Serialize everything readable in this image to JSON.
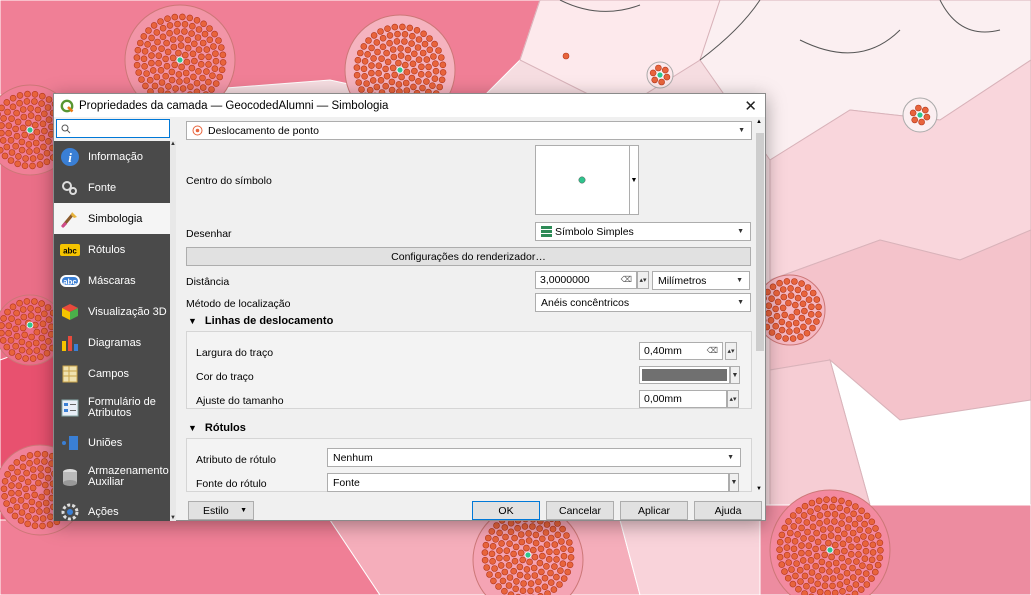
{
  "dialog": {
    "title": "Propriedades da camada — GeocodedAlumni — Simbologia",
    "close_glyph": "✕"
  },
  "sidebar": {
    "search_placeholder": "",
    "items": [
      {
        "label": "Informação",
        "icon": "info-icon"
      },
      {
        "label": "Fonte",
        "icon": "source-icon"
      },
      {
        "label": "Simbologia",
        "icon": "symbology-icon",
        "active": true
      },
      {
        "label": "Rótulos",
        "icon": "labels-icon"
      },
      {
        "label": "Máscaras",
        "icon": "masks-icon"
      },
      {
        "label": "Visualização 3D",
        "icon": "3d-view-icon"
      },
      {
        "label": "Diagramas",
        "icon": "diagrams-icon"
      },
      {
        "label": "Campos",
        "icon": "fields-icon"
      },
      {
        "label": "Formulário de Atributos",
        "icon": "attributes-form-icon"
      },
      {
        "label": "Uniões",
        "icon": "joins-icon"
      },
      {
        "label": "Armazenamento Auxiliar",
        "icon": "aux-storage-icon"
      },
      {
        "label": "Ações",
        "icon": "actions-icon"
      }
    ],
    "badge_abc": "abc"
  },
  "renderer": {
    "type": "Deslocamento de ponto",
    "center_symbol_label": "Centro do símbolo",
    "draw_label": "Desenhar",
    "draw_value": "Símbolo Simples",
    "renderer_settings_button": "Configurações do renderizador…",
    "distance_label": "Distância",
    "distance_value": "3,0000000",
    "distance_unit": "Milímetros",
    "placement_label": "Método de localização",
    "placement_value": "Anéis concêntricos"
  },
  "displacement_lines": {
    "header": "Linhas de deslocamento",
    "stroke_width_label": "Largura do traço",
    "stroke_width_value": "0,40mm",
    "stroke_color_label": "Cor do traço",
    "stroke_color": "#707070",
    "size_adjust_label": "Ajuste do tamanho",
    "size_adjust_value": "0,00mm"
  },
  "labels": {
    "header": "Rótulos",
    "attribute_label": "Atributo de rótulo",
    "attribute_value": "Nenhum",
    "font_label": "Fonte do rótulo",
    "font_value": "Fonte"
  },
  "bottom": {
    "style_button": "Estilo",
    "ok": "OK",
    "cancel": "Cancelar",
    "apply": "Aplicar",
    "help": "Ajuda"
  },
  "colors": {
    "accent": "#0078d7",
    "sidebar_bg": "#4a4a4a",
    "point_fill": "#e8643c",
    "center_point": "#2fc48d"
  }
}
